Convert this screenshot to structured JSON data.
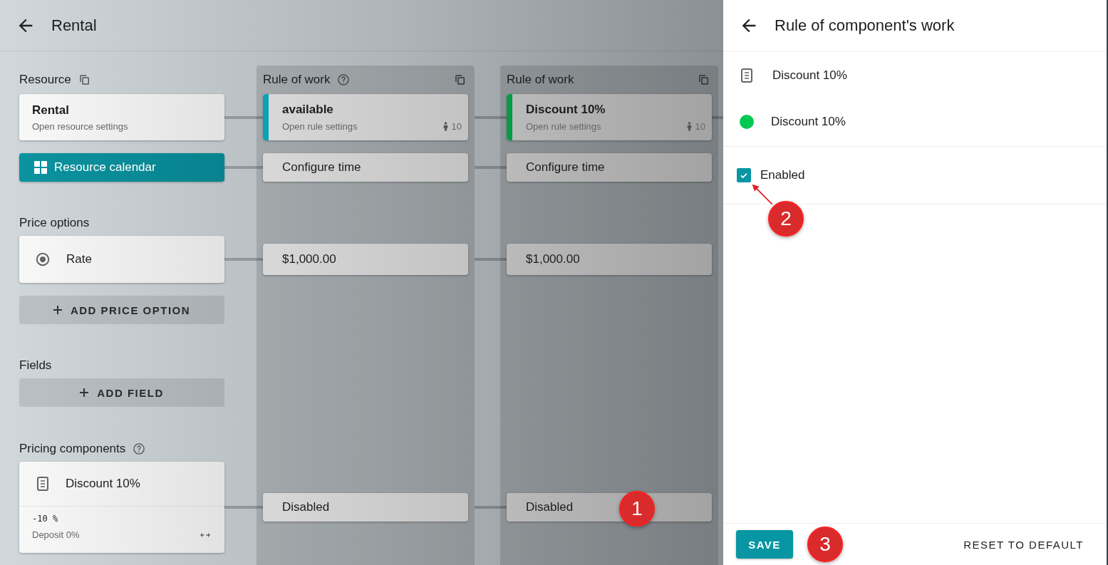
{
  "header": {
    "title": "Rental"
  },
  "resource": {
    "label": "Resource",
    "card": {
      "title": "Rental",
      "subtitle": "Open resource settings"
    },
    "calendar_button": "Resource calendar"
  },
  "price_options": {
    "label": "Price options",
    "items": [
      {
        "label": "Rate",
        "selected": true
      }
    ],
    "add_button": "ADD PRICE OPTION"
  },
  "fields": {
    "label": "Fields",
    "add_button": "ADD FIELD"
  },
  "pricing_components": {
    "label": "Pricing components",
    "items": [
      {
        "title": "Discount 10%",
        "value": "-10 %",
        "deposit": "Deposit 0%"
      }
    ]
  },
  "rule_columns": [
    {
      "title": "Rule of work",
      "help": true,
      "color": "#0aa3b3",
      "rule": {
        "title": "available",
        "subtitle": "Open rule settings",
        "count": "10"
      },
      "time": "Configure time",
      "prices": [
        "$1,000.00"
      ],
      "components": [
        "Disabled"
      ]
    },
    {
      "title": "Rule of work",
      "help": false,
      "color": "#079a45",
      "rule": {
        "title": "Discount 10%",
        "subtitle": "Open rule settings",
        "count": "10"
      },
      "time": "Configure time",
      "prices": [
        "$1,000.00"
      ],
      "components": [
        "Disabled"
      ]
    }
  ],
  "panel": {
    "title": "Rule of component's work",
    "component": "Discount 10%",
    "rule": {
      "name": "Discount 10%",
      "color": "#00c853"
    },
    "enabled": {
      "label": "Enabled",
      "checked": true
    },
    "save_button": "SAVE",
    "reset_button": "RESET TO DEFAULT"
  },
  "annotations": [
    "1",
    "2",
    "3"
  ]
}
